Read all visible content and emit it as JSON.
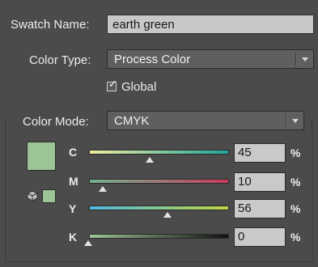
{
  "swatch_name": {
    "label": "Swatch Name:",
    "value": "earth green"
  },
  "color_type": {
    "label": "Color Type:",
    "value": "Process Color"
  },
  "global": {
    "label": "Global",
    "checked": true
  },
  "color_mode": {
    "label": "Color Mode:",
    "value": "CMYK"
  },
  "swatch_color": "#9dc496",
  "channels": [
    {
      "label": "C",
      "value": "45",
      "unit": "%",
      "fraction": 0.45
    },
    {
      "label": "M",
      "value": "10",
      "unit": "%",
      "fraction": 0.1
    },
    {
      "label": "Y",
      "value": "56",
      "unit": "%",
      "fraction": 0.56
    },
    {
      "label": "K",
      "value": "0",
      "unit": "%",
      "fraction": 0.0
    }
  ],
  "icons": {
    "cube": "cube-icon",
    "gamut": "small-swatch"
  }
}
